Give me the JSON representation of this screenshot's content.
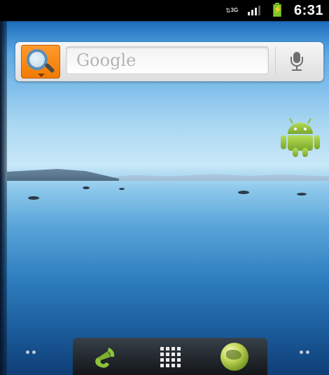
{
  "status_bar": {
    "network_type": "3G",
    "network_icon": "data-arrows-icon",
    "signal_icon": "signal-strength-icon",
    "signal_bars": 3,
    "signal_max": 4,
    "battery_icon": "battery-charging-icon",
    "time": "6:31"
  },
  "search_widget": {
    "search_icon": "magnifier-icon",
    "placeholder": "Google",
    "voice_icon": "microphone-icon",
    "accent_color": "#f07a00"
  },
  "home_screen": {
    "shortcut_icon": "android-robot-icon",
    "android_color": "#9bc53d"
  },
  "dock": {
    "phone_icon": "phone-handset-icon",
    "apps_icon": "app-drawer-grid-icon",
    "browser_icon": "browser-globe-icon"
  },
  "pager": {
    "left_icon": "page-indicator-dots-icon",
    "right_icon": "page-indicator-dots-icon"
  }
}
